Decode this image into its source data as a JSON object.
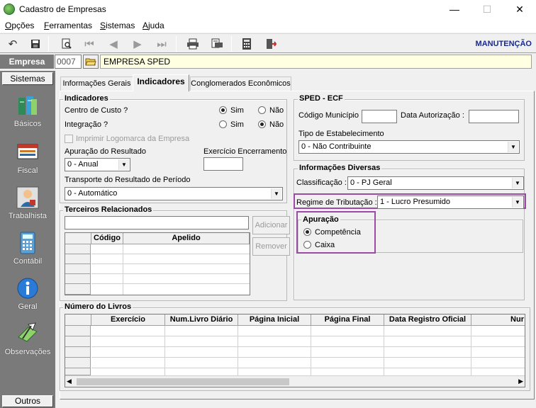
{
  "window": {
    "title": "Cadastro de Empresas",
    "minimize": "—",
    "maximize": "☐",
    "close": "✕"
  },
  "menu": {
    "items": [
      "Opções",
      "Ferramentas",
      "Sistemas",
      "Ajuda"
    ]
  },
  "toolbar": {
    "icons": [
      "undo-icon",
      "save-icon",
      "preview-icon",
      "first-icon",
      "prev-icon",
      "next-icon",
      "last-icon",
      "print-icon",
      "print-setup-icon",
      "calculator-icon",
      "exit-icon"
    ],
    "mode": "MANUTENÇÃO"
  },
  "empresa": {
    "label": "Empresa",
    "code": "0007",
    "name": "EMPRESA SPED"
  },
  "sidebar": {
    "header": "Sistemas",
    "footer": "Outros",
    "items": [
      {
        "label": "Básicos",
        "icon": "books-icon"
      },
      {
        "label": "Fiscal",
        "icon": "fiscal-icon"
      },
      {
        "label": "Trabalhista",
        "icon": "worker-icon"
      },
      {
        "label": "Contábil",
        "icon": "calculator-icon"
      },
      {
        "label": "Geral",
        "icon": "info-icon"
      },
      {
        "label": "Observações",
        "icon": "notes-icon"
      }
    ]
  },
  "tabs": [
    "Informações Gerais",
    "Indicadores",
    "Conglomerados Econômicos"
  ],
  "indicadores": {
    "title": "Indicadores",
    "centro_custo": "Centro de Custo ?",
    "integracao": "Integração ?",
    "sim": "Sim",
    "nao": "Não",
    "imprimir_logo": "Imprimir Logomarca da Empresa",
    "apuracao_resultado": "Apuração do Resultado",
    "apuracao_resultado_value": "0 - Anual",
    "exercicio_encerramento": "Exercício Encerramento",
    "exercicio_encerramento_value": "",
    "transporte": "Transporte do Resultado de Período",
    "transporte_value": "0 - Automático"
  },
  "terceiros": {
    "title": "Terceiros Relacionados",
    "adicionar": "Adicionar",
    "remover": "Remover",
    "columns": [
      "Código",
      "Apelido"
    ]
  },
  "livros": {
    "title": "Número do Livros",
    "columns": [
      "Exercício",
      "Num.Livro Diário",
      "Página Inicial",
      "Página Final",
      "Data Registro Oficial",
      "Nur"
    ]
  },
  "sped": {
    "title": "SPED - ECF",
    "codigo_municipio": "Código Município :",
    "data_autorizacao": "Data Autorização :",
    "tipo_estabelecimento": "Tipo de Estabelecimento",
    "tipo_estabelecimento_value": "0 - Não Contribuinte"
  },
  "diversas": {
    "title": "Informações Diversas",
    "classificacao": "Classificação :",
    "classificacao_value": "0 - PJ Geral",
    "regime": "Regime de Tributação :",
    "regime_value": "1 - Lucro Presumido"
  },
  "apuracao": {
    "title": "Apuração",
    "competencia": "Competência",
    "caixa": "Caixa"
  },
  "colors": {
    "highlight": "#9b4aa5",
    "sidebar": "#7a7a7a",
    "mode_text": "#1a2a8c",
    "name_field": "#ffffe1"
  }
}
